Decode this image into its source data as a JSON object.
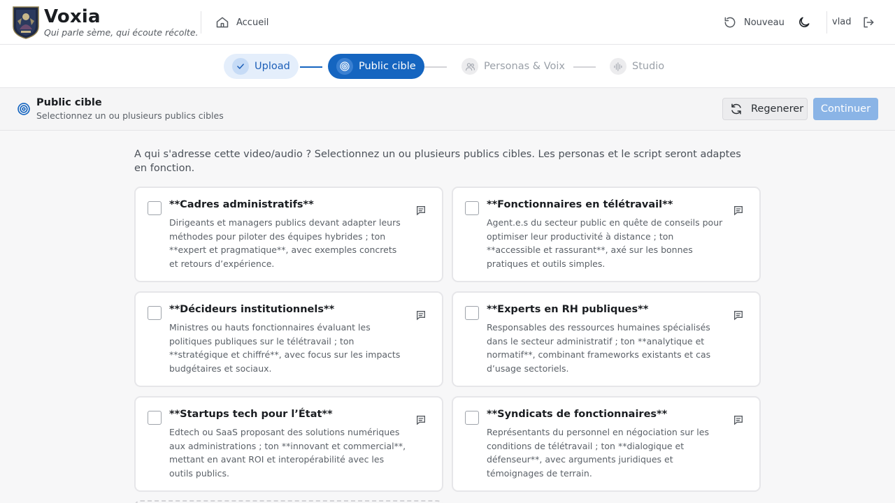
{
  "app": {
    "title": "Voxia",
    "tagline": "Qui parle sème, qui écoute récolte."
  },
  "nav": {
    "home_label": "Accueil",
    "new_label": "Nouveau",
    "user": "vlad"
  },
  "stepper": {
    "steps": [
      {
        "label": "Upload",
        "state": "done",
        "icon": "check-icon"
      },
      {
        "label": "Public cible",
        "state": "active",
        "icon": "target-icon"
      },
      {
        "label": "Personas & Voix",
        "state": "todo",
        "icon": "users-icon"
      },
      {
        "label": "Studio",
        "state": "todo",
        "icon": "audio-wave-icon"
      }
    ]
  },
  "section": {
    "title": "Public cible",
    "subtitle": "Selectionnez un ou plusieurs publics cibles",
    "regen_label": "Regenerer",
    "continue_label": "Continuer"
  },
  "intro": "A qui s'adresse cette video/audio ? Selectionnez un ou plusieurs publics cibles. Les personas et le script seront adaptes en fonction.",
  "audiences": [
    {
      "title": "**Cadres administratifs**",
      "description": "Dirigeants et managers publics devant adapter leurs méthodes pour piloter des équipes hybrides ; ton **expert et pragmatique**, avec exemples concrets et retours d’expérience.",
      "checked": false
    },
    {
      "title": "**Fonctionnaires en télétravail**",
      "description": "Agent.e.s du secteur public en quête de conseils pour optimiser leur productivité à distance ; ton **accessible et rassurant**, axé sur les bonnes pratiques et outils simples.",
      "checked": false
    },
    {
      "title": "**Décideurs institutionnels**",
      "description": "Ministres ou hauts fonctionnaires évaluant les politiques publiques sur le télétravail ; ton **stratégique et chiffré**, avec focus sur les impacts budgétaires et sociaux.",
      "checked": false
    },
    {
      "title": "**Experts en RH publiques**",
      "description": "Responsables des ressources humaines spécialisés dans le secteur administratif ; ton **analytique et normatif**, combinant frameworks existants et cas d’usage sectoriels.",
      "checked": false
    },
    {
      "title": "**Startups tech pour l’État**",
      "description": "Edtech ou SaaS proposant des solutions numériques aux administrations ; ton **innovant et commercial**, mettant en avant ROI et interopérabilité avec les outils publics.",
      "checked": false
    },
    {
      "title": "**Syndicats de fonctionnaires**",
      "description": "Représentants du personnel en négociation sur les conditions de télétravail ; ton **dialogique et défenseur**, avec arguments juridiques et témoignages de terrain.",
      "checked": false
    }
  ],
  "colors": {
    "accent": "#1565c0",
    "accent_light": "#e4eefb",
    "continue_disabled": "#8ab4e6"
  }
}
